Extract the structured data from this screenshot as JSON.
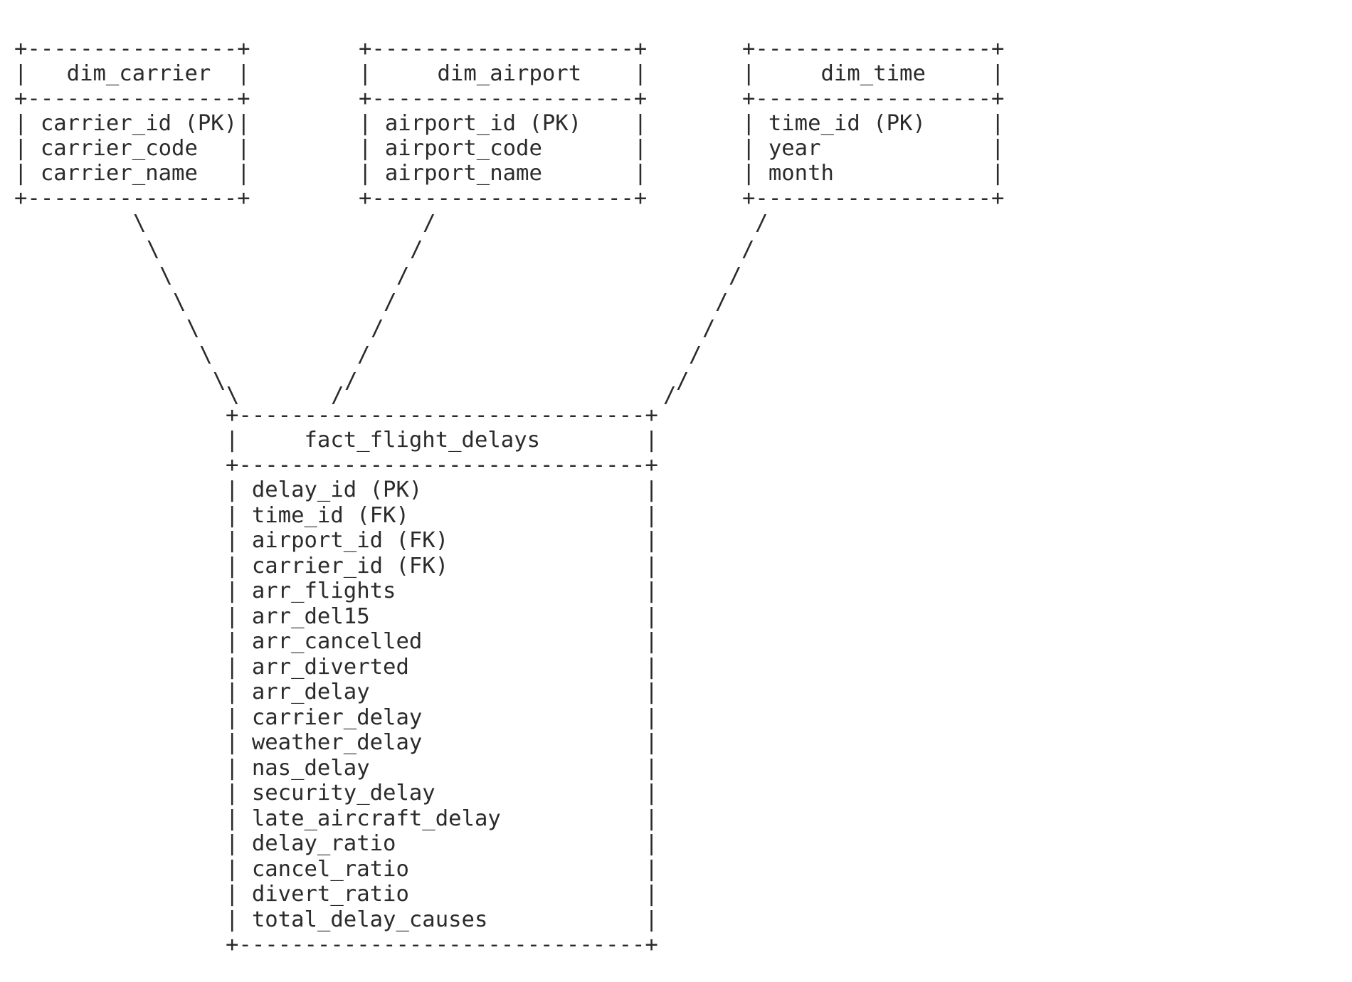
{
  "diagram": {
    "tables": {
      "dim_carrier": {
        "name": "dim_carrier",
        "lines": [
          "+----------------+",
          "|   dim_carrier  |",
          "+----------------+",
          "| carrier_id (PK)|",
          "| carrier_code   |",
          "| carrier_name   |",
          "+----------------+"
        ]
      },
      "dim_airport": {
        "name": "dim_airport",
        "lines": [
          "+--------------------+",
          "|     dim_airport    |",
          "+--------------------+",
          "| airport_id (PK)    |",
          "| airport_code       |",
          "| airport_name       |",
          "+--------------------+"
        ]
      },
      "dim_time": {
        "name": "dim_time",
        "lines": [
          "+------------------+",
          "|     dim_time     |",
          "+------------------+",
          "| time_id (PK)     |",
          "| year             |",
          "| month            |",
          "+------------------+"
        ]
      },
      "fact_flight_delays": {
        "name": "fact_flight_delays",
        "lines": [
          "+-------------------------------+",
          "|     fact_flight_delays        |",
          "+-------------------------------+",
          "| delay_id (PK)                 |",
          "| time_id (FK)                  |",
          "| airport_id (FK)               |",
          "| carrier_id (FK)               |",
          "| arr_flights                   |",
          "| arr_del15                     |",
          "| arr_cancelled                 |",
          "| arr_diverted                  |",
          "| arr_delay                     |",
          "| carrier_delay                 |",
          "| weather_delay                 |",
          "| nas_delay                     |",
          "| security_delay                |",
          "| late_aircraft_delay           |",
          "| delay_ratio                   |",
          "| cancel_ratio                  |",
          "| divert_ratio                  |",
          "| total_delay_causes            |",
          "+-------------------------------+"
        ]
      }
    },
    "connectors": {
      "backslash": "\\",
      "slash": "/"
    }
  }
}
